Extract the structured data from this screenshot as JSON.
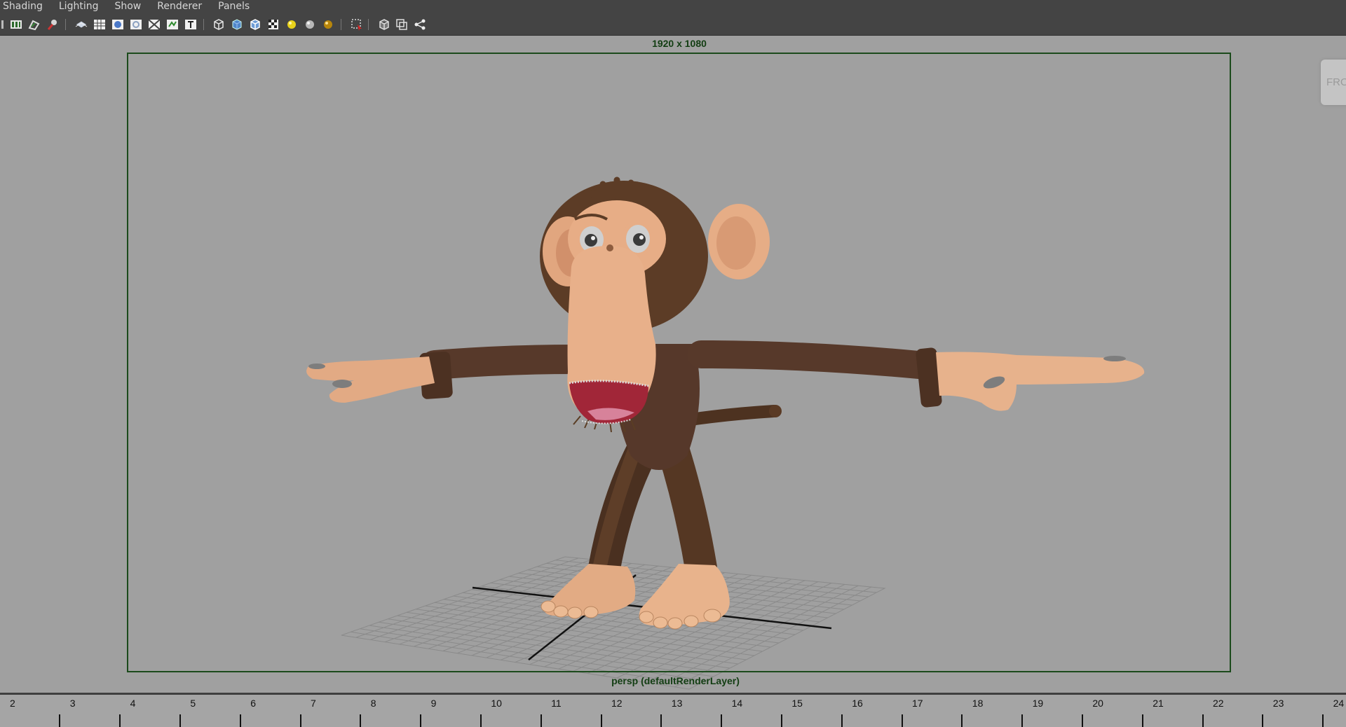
{
  "menubar": {
    "items": [
      "Shading",
      "Lighting",
      "Show",
      "Renderer",
      "Panels"
    ]
  },
  "toolbar": {
    "icons": [
      "select-camera-icon",
      "camera-attributes-icon",
      "bookmarks-icon",
      "image-plane-icon",
      "grid-icon",
      "film-gate-icon",
      "resolution-gate-icon",
      "gate-mask-icon",
      "field-chart-icon",
      "safe-action-icon",
      "safe-title-icon",
      "wireframe-icon",
      "smooth-shade-icon",
      "wireframe-on-shaded-icon",
      "textured-icon",
      "use-default-lighting-icon",
      "use-all-lights-icon",
      "shadows-icon",
      "isolate-select-icon",
      "xray-icon",
      "xray-joints-icon",
      "hide-controls-icon"
    ]
  },
  "viewport": {
    "resolution_label": "1920 x 1080",
    "camera_label": "persp (defaultRenderLayer)",
    "viewcube_label": "FRONT",
    "gate_color": "#1b4a1b",
    "background_color": "#a0a0a0"
  },
  "timeline": {
    "frames": [
      2,
      3,
      4,
      5,
      6,
      7,
      8,
      9,
      10,
      11,
      12,
      13,
      14,
      15,
      16,
      17,
      18,
      19,
      20,
      21,
      22,
      23,
      24
    ]
  },
  "colors": {
    "fur": "#5a3c27",
    "skin": "#e6ad86",
    "mouth": "#a22a3b",
    "ui_dark": "#444444"
  }
}
